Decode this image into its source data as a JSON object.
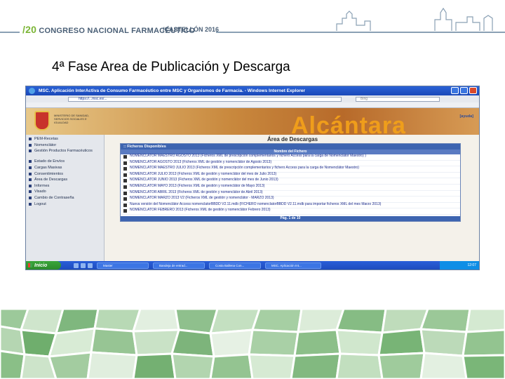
{
  "slide": {
    "congress_prefix": "/20",
    "congress_name": "CONGRESO NACIONAL FARMACÉUTICO",
    "city": "/CASTELLÓN 2016",
    "title": "4ª Fase Area de Publicación y Descarga"
  },
  "browser": {
    "window_title": "MSC. Aplicación InterActiva de Consumo Farmacéutico entre MSC y Organismos de Farmacia. - Windows Internet Explorer",
    "address": "https://...msc.es/...",
    "search_placeholder": "Bing"
  },
  "app": {
    "ministry_text": "MINISTERIO DE SANIDAD, SERVICIOS SOCIALES E IGUALDAD",
    "banner_brand": "Alcántara",
    "help_link": "[ayuda]",
    "sidebar": {
      "items": [
        {
          "label": "PEM-Recetas"
        },
        {
          "label": "Nomenclátor"
        },
        {
          "label": "Gestión Productos Farmacéuticos"
        },
        {
          "label": "Estado de Envíos"
        },
        {
          "label": "Cargas Masivas"
        },
        {
          "label": "Consentimientos"
        },
        {
          "label": "Área de Descargas"
        },
        {
          "label": "Informes"
        },
        {
          "label": "Visado"
        },
        {
          "label": "Cambio de Contraseña"
        },
        {
          "label": "Logout"
        }
      ]
    },
    "downloads": {
      "page_title": "Área de Descargas",
      "panel_title": ":: Ficheros Disponibles",
      "column_header": "Nombre del Fichero",
      "files": [
        "NOMENCLATOR MAESTRO AGOSTO 2013 (Ficheros XML de prescripción complementarios y fichero Access para la carga de Nomenclátor Maestro) )",
        "NOMENCLATOR AGOSTO 2013 (Ficheros XML de gestión y nomenclátor de Agosto 2013)",
        "NOMENCLATOR MAESTRO JULIO 2013 (Ficheros XML de prescripción complementarios y fichero Access para la carga de Nomenclátor Maestro)",
        "NOMENCLATOR JULIO 2013 (Ficheros XML de gestión y nomenclátor del mes de Julio 2013)",
        "NOMENCLATOR JUNIO 2013 (Ficheros XML de gestión y nomenclátor del mes de Junio 2013)",
        "NOMENCLATOR MAYO 2013 (Ficheros XML de gestión y nomenclátor de Mayo 2013)",
        "NOMENCLATOR ABRIL 2013 (Ficheros XML de gestión y nomenclátor de Abril 2013)",
        "NOMENCLATOR MARZO 2013 V2 (Ficheros XML de gestión y nomenclátor - MARZO 2013)",
        "Nueva versión del Nomenclátor Access nomenclatorBBDD V2.11.mdb (FICHERO nomenclatorBBDD V2.11.mdb para importar ficheros XML del mes Marzo 2013)",
        "NOMENCLATOR FEBRERO 2013 (Ficheros XML de gestión y nomenclátor Febrero 2013)"
      ],
      "pager": "Pág. 1 de 10"
    }
  },
  "taskbar": {
    "start_label": "Inicio",
    "tasks": [
      "Master",
      "Bandeja de entrad...",
      "Costa Ballena Con...",
      "MSC. Aplicación Int..."
    ],
    "clock": "12:07"
  },
  "colors": {
    "accent_green": "#7bb536",
    "header_text": "#4a5f76",
    "panel_blue": "#3d64b0"
  }
}
